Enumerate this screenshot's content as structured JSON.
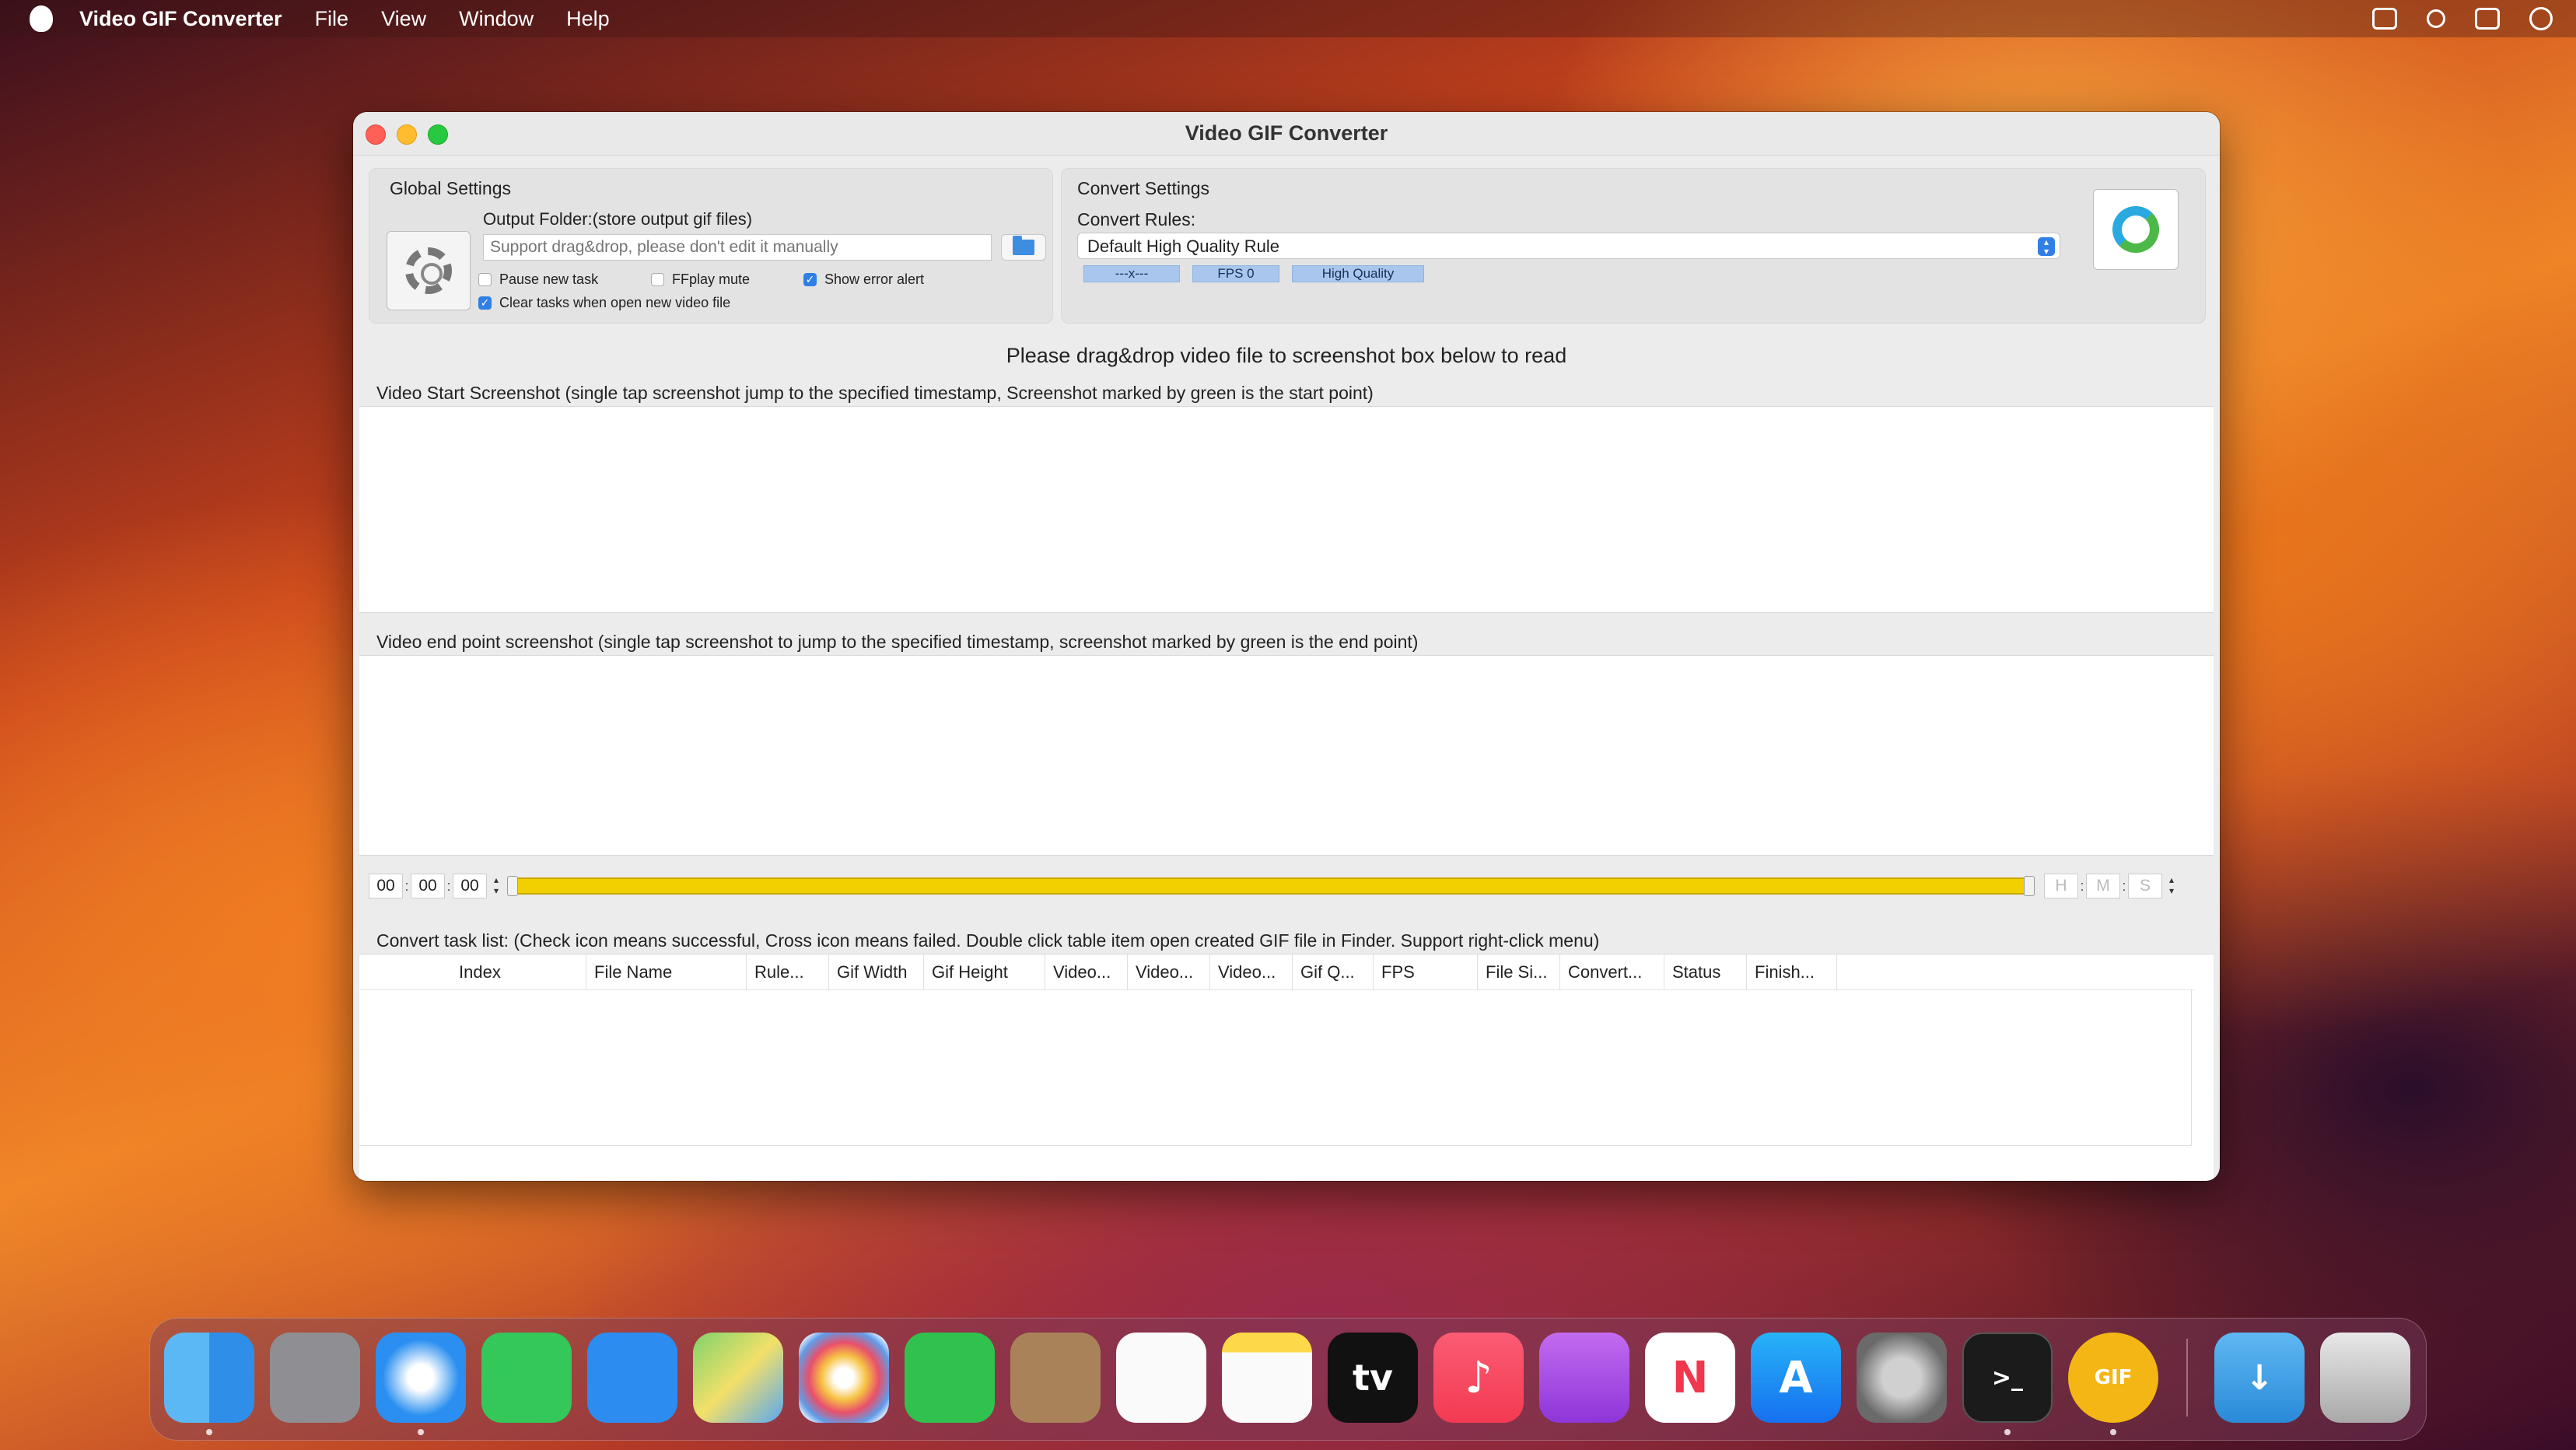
{
  "menubar": {
    "app_name": "Video GIF Converter",
    "items": [
      "File",
      "View",
      "Window",
      "Help"
    ]
  },
  "window": {
    "title": "Video GIF Converter"
  },
  "global_settings": {
    "label": "Global Settings",
    "output_folder_label": "Output Folder:(store output gif files)",
    "output_folder_placeholder": "Support drag&drop, please don't edit it manually",
    "output_folder_value": "",
    "checkboxes": [
      {
        "label": "Pause new task",
        "checked": false
      },
      {
        "label": "FFplay mute",
        "checked": false
      },
      {
        "label": "Show error alert",
        "checked": true
      },
      {
        "label": "Clear tasks when open new video file",
        "checked": true
      }
    ]
  },
  "convert_settings": {
    "label": "Convert Settings",
    "rules_label": "Convert Rules:",
    "selected_rule": "Default High Quality Rule",
    "tags": [
      "---x---",
      "FPS 0",
      "High Quality"
    ]
  },
  "drop_hint": "Please drag&drop video file to screenshot box below to read",
  "start_screenshot_label": "Video Start Screenshot (single tap screenshot jump to the specified timestamp, Screenshot marked by green is the start point)",
  "end_screenshot_label": "Video end point screenshot (single tap screenshot to jump to the specified timestamp, screenshot marked by green is the end point)",
  "timeline": {
    "start_h": "00",
    "start_m": "00",
    "start_s": "00",
    "end_h_placeholder": "H",
    "end_m_placeholder": "M",
    "end_s_placeholder": "S"
  },
  "task_list": {
    "label": "Convert task list: (Check icon means successful, Cross icon means failed. Double click table item open created GIF file in Finder. Support right-click menu)",
    "columns": [
      "Index",
      "File Name",
      "Rule...",
      "Gif Width",
      "Gif Height",
      "Video...",
      "Video...",
      "Video...",
      "Gif Q...",
      "FPS",
      "File Si...",
      "Convert...",
      "Status",
      "Finish..."
    ],
    "rows": []
  },
  "dock": {
    "apps": [
      "Finder",
      "Launchpad",
      "Safari",
      "Messages",
      "Mail",
      "Maps",
      "Photos",
      "FaceTime",
      "Contacts",
      "Reminders",
      "Notes",
      "TV",
      "Music",
      "Podcasts",
      "News",
      "App Store",
      "System Settings",
      "Terminal",
      "Video GIF Converter",
      "Downloads",
      "Trash"
    ],
    "tv_label": "tv"
  }
}
